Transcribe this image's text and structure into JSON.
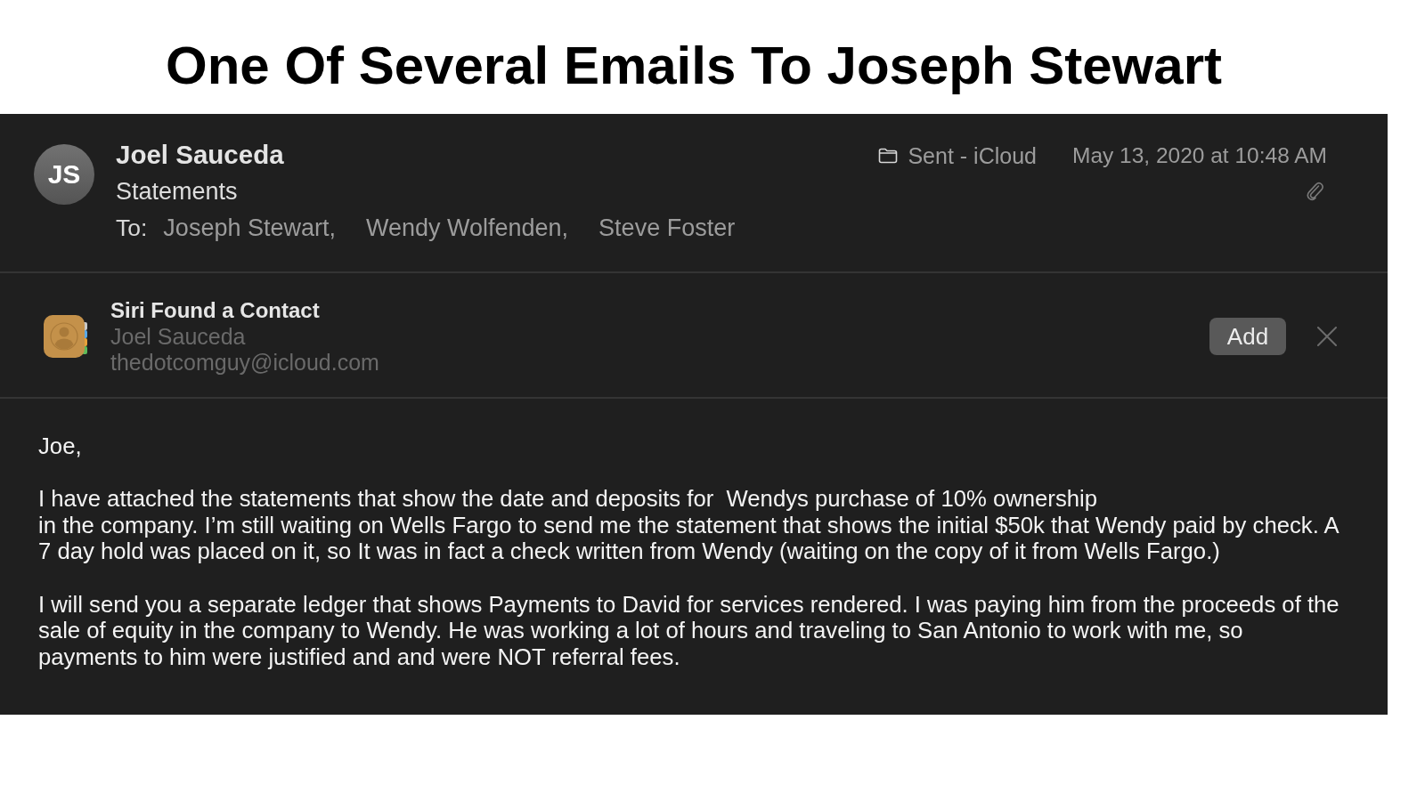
{
  "page_title": "One Of Several Emails To Joseph Stewart",
  "message": {
    "avatar_initials": "JS",
    "sender": "Joel Sauceda",
    "subject": "Statements",
    "to_label": "To:",
    "recipients": [
      "Joseph Stewart,",
      "Wendy Wolfenden,",
      "Steve Foster"
    ],
    "mailbox": "Sent - iCloud",
    "date": "May 13, 2020 at 10:48 AM",
    "has_attachment": true
  },
  "siri_banner": {
    "title": "Siri Found a Contact",
    "name": "Joel Sauceda",
    "email": "thedotcomguy@icloud.com",
    "add_button": "Add"
  },
  "body": {
    "greeting": "Joe,",
    "paragraphs": [
      "I have attached the statements that show the date and deposits for  Wendys purchase of 10% ownership\nin the company. I’m still waiting on Wells Fargo to send me the statement that shows the initial $50k that Wendy paid by check. A 7 day hold was placed on it, so It was in fact a check written from Wendy (waiting on the copy of it from Wells Fargo.)",
      "I will send you a separate ledger that shows Payments to David for services rendered. I was paying him from the proceeds of the sale of equity in the company to Wendy. He was working a lot of hours and traveling to San Antonio to work with me, so payments to him were justified and and were NOT referral fees."
    ]
  }
}
